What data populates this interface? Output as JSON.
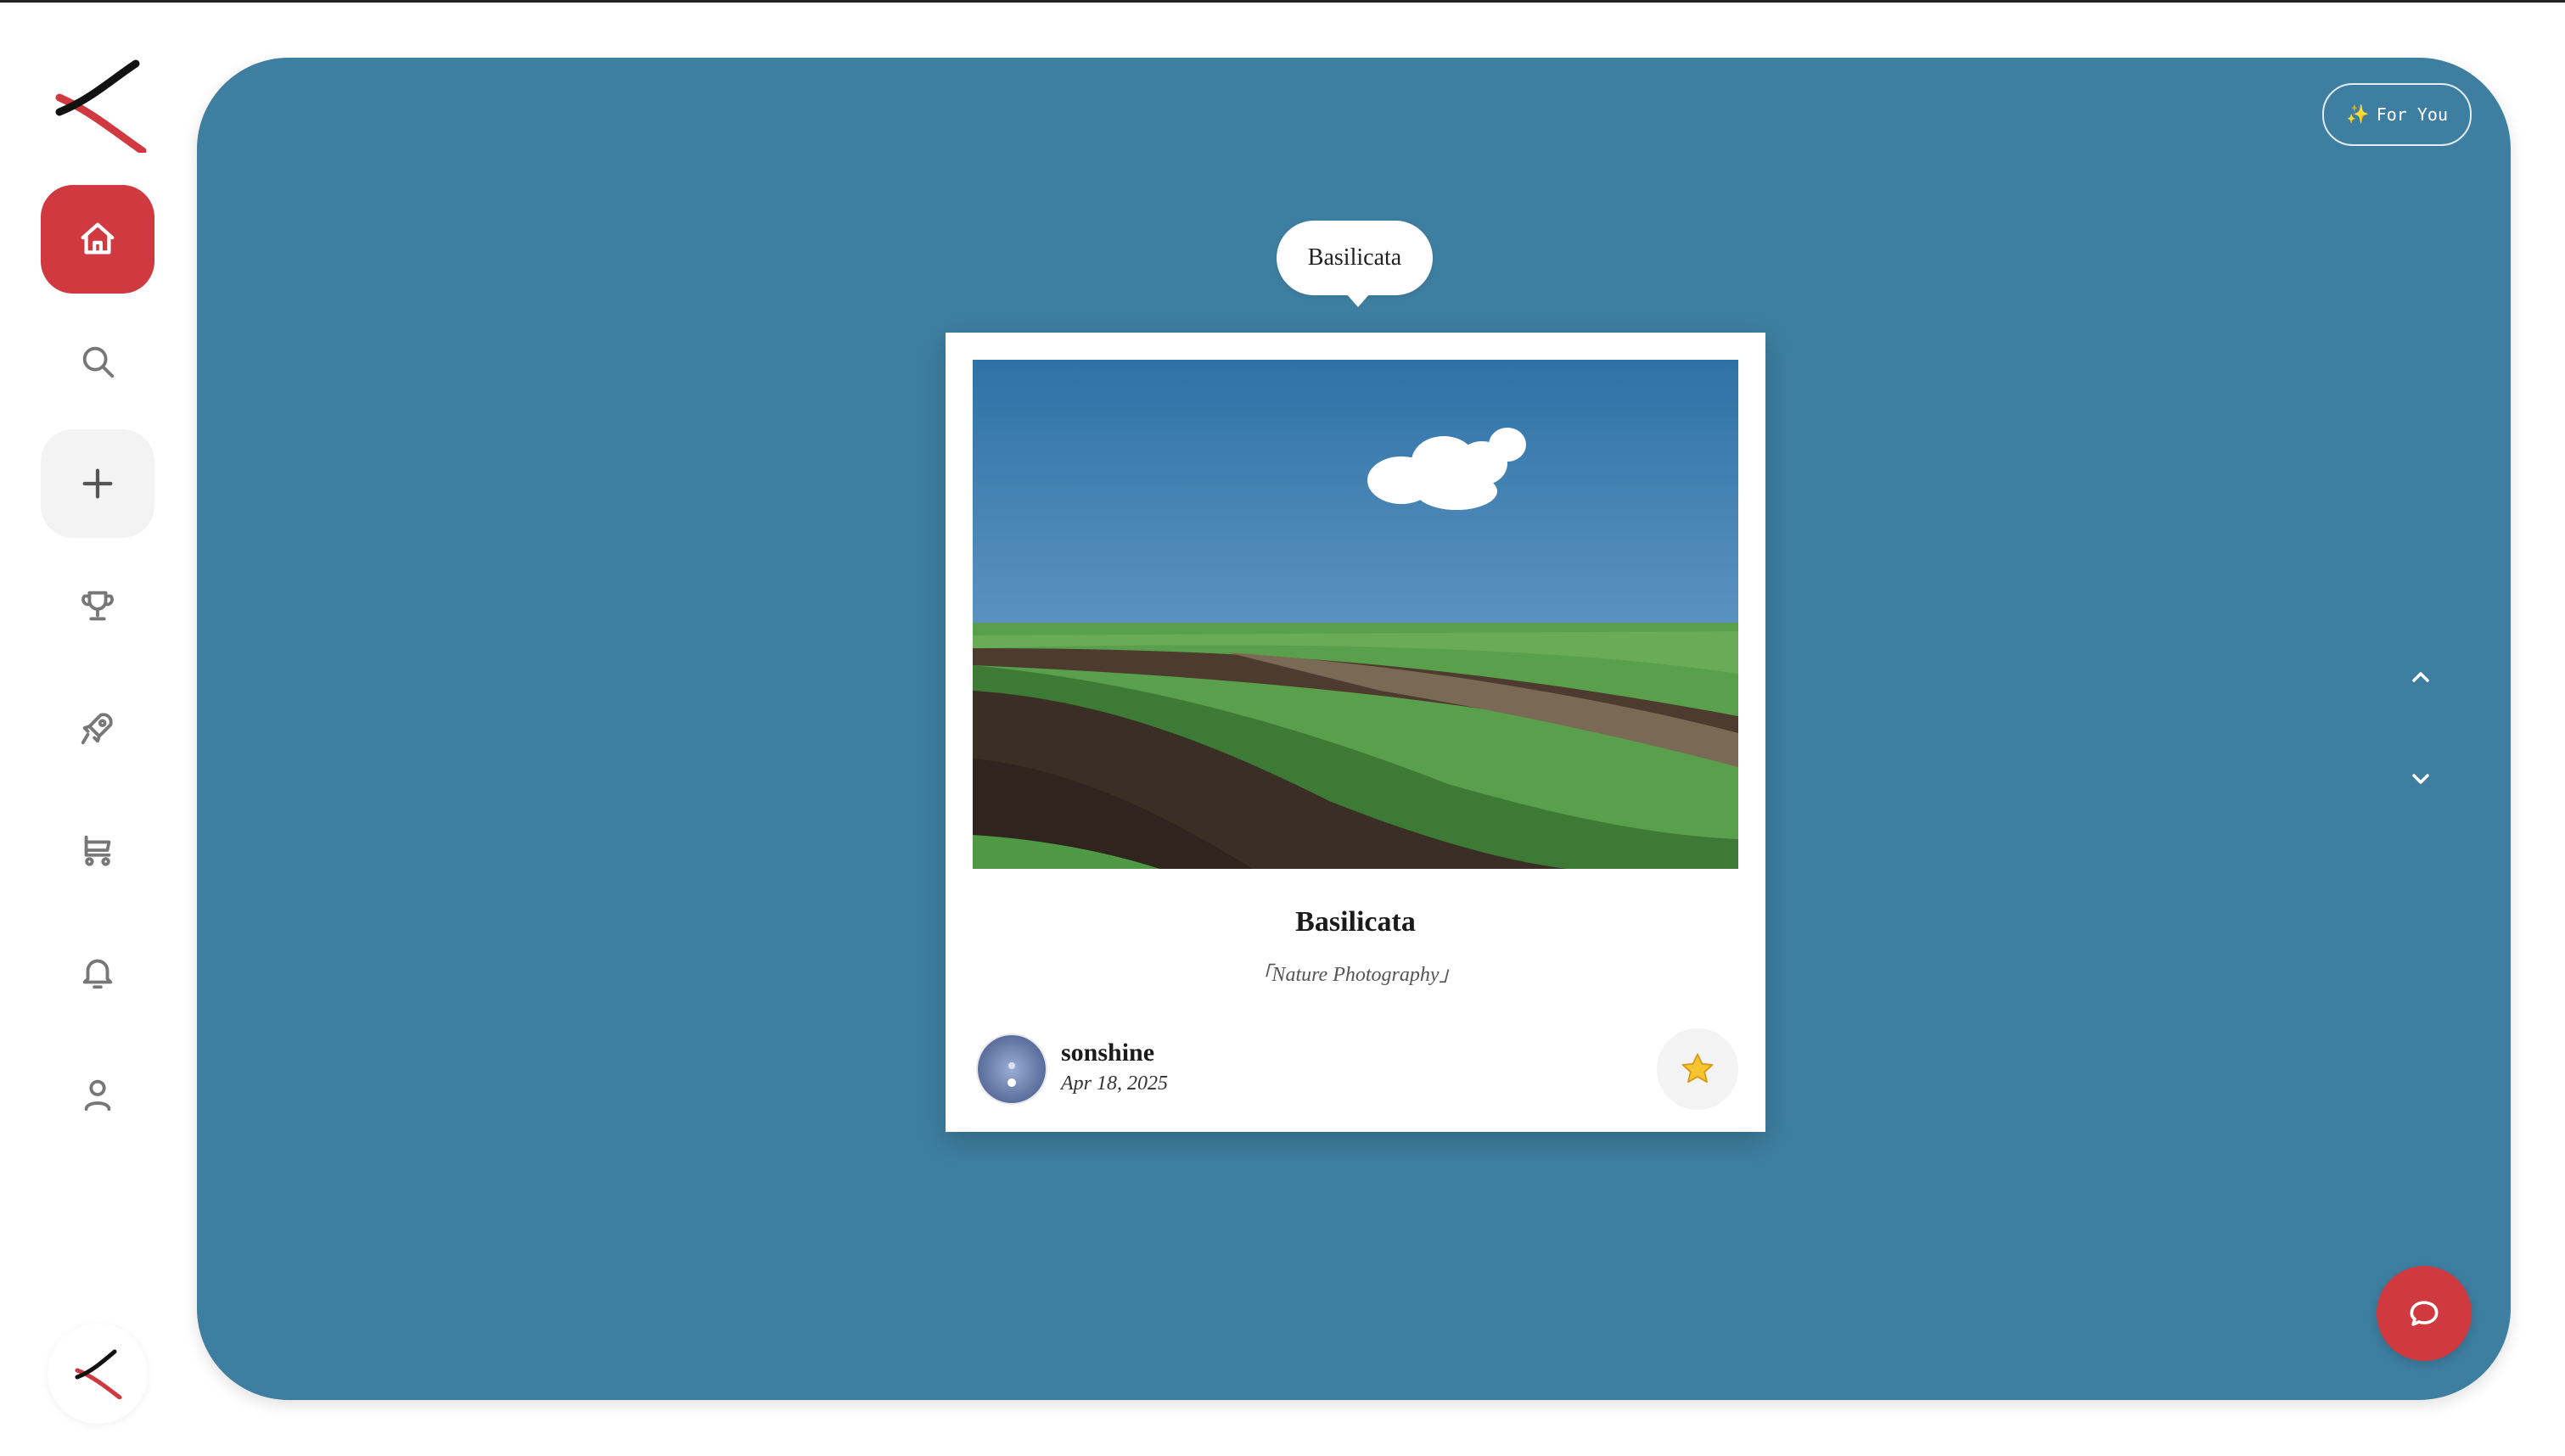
{
  "colors": {
    "accent": "#d0393f",
    "panel": "#3e7ea0",
    "card": "#ffffff"
  },
  "sidebar": {
    "items": [
      {
        "name": "home",
        "icon": "home-icon",
        "active": true
      },
      {
        "name": "search",
        "icon": "search-icon"
      },
      {
        "name": "create",
        "icon": "plus-icon"
      },
      {
        "name": "trophy",
        "icon": "trophy-icon"
      },
      {
        "name": "launch",
        "icon": "rocket-icon"
      },
      {
        "name": "cart",
        "icon": "cart-icon"
      },
      {
        "name": "notifications",
        "icon": "bell-icon"
      },
      {
        "name": "profile",
        "icon": "user-icon"
      }
    ]
  },
  "header": {
    "for_you_label": "For You"
  },
  "tooltip": {
    "text": "Basilicata"
  },
  "post": {
    "title": "Basilicata",
    "category": "「Nature Photography」",
    "author": "sonshine",
    "date": "Apr 18, 2025"
  },
  "controls": {
    "up_icon": "chevron-up-icon",
    "down_icon": "chevron-down-icon",
    "chat_icon": "chat-bubble-icon",
    "star_icon": "star-icon"
  }
}
